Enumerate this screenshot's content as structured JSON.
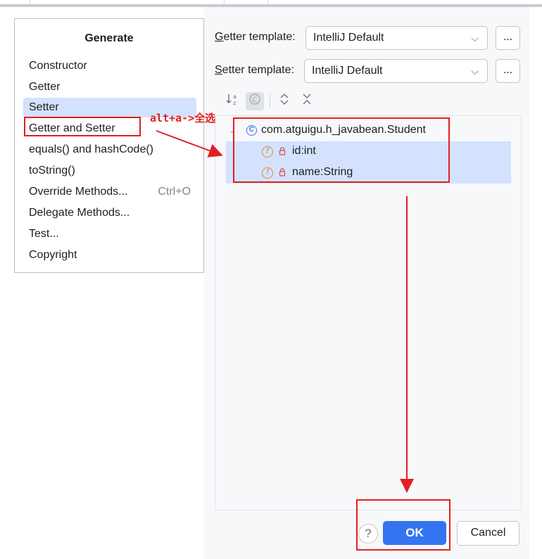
{
  "generate_popup": {
    "title": "Generate",
    "items": [
      {
        "label": "Constructor",
        "shortcut": ""
      },
      {
        "label": "Getter",
        "shortcut": ""
      },
      {
        "label": "Setter",
        "shortcut": ""
      },
      {
        "label": "Getter and Setter",
        "shortcut": ""
      },
      {
        "label": "equals() and hashCode()",
        "shortcut": ""
      },
      {
        "label": "toString()",
        "shortcut": ""
      },
      {
        "label": "Override Methods...",
        "shortcut": "Ctrl+O"
      },
      {
        "label": "Delegate Methods...",
        "shortcut": ""
      },
      {
        "label": "Test...",
        "shortcut": ""
      },
      {
        "label": "Copyright",
        "shortcut": ""
      }
    ],
    "selected_index": 2
  },
  "annotation": {
    "shortcut_note": "alt+a->全选",
    "color": "#e02020"
  },
  "templates": {
    "getter_label_mnemonic": "G",
    "getter_label_rest": "etter template:",
    "getter_value": "IntelliJ Default",
    "setter_label_mnemonic": "S",
    "setter_label_rest": "etter template:",
    "setter_value": "IntelliJ Default",
    "browse_label": "..."
  },
  "toolbar": {
    "sort_icon": "sort-alphabetically-icon",
    "show_classes_icon": "show-classes-icon",
    "expand_icon": "expand-all-icon",
    "collapse_icon": "collapse-all-icon"
  },
  "tree": {
    "class_name": "com.atguigu.h_javabean.Student",
    "class_icon_glyph": "C",
    "field_icon_glyph": "f",
    "fields": [
      "id:int",
      "name:String"
    ]
  },
  "buttons": {
    "help": "?",
    "ok": "OK",
    "cancel": "Cancel"
  },
  "colors": {
    "accent": "#3574f0",
    "selection": "#d4e2ff",
    "annotation_red": "#e02020"
  }
}
